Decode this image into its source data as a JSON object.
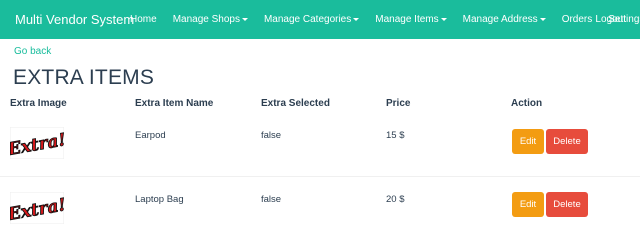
{
  "navbar": {
    "brand": "Multi Vendor System",
    "items": [
      {
        "label": "Home",
        "dropdown": false
      },
      {
        "label": "Manage Shops",
        "dropdown": true
      },
      {
        "label": "Manage Categories",
        "dropdown": true
      },
      {
        "label": "Manage Items",
        "dropdown": true
      },
      {
        "label": "Manage Address",
        "dropdown": true
      },
      {
        "label": "Orders",
        "dropdown": false
      },
      {
        "label": "Settings",
        "dropdown": true
      }
    ],
    "logout": "Logout"
  },
  "go_back": "Go back",
  "page_title": "EXTRA ITEMS",
  "table": {
    "headers": [
      "Extra Image",
      "Extra Item Name",
      "Extra Selected",
      "Price",
      "Action"
    ],
    "rows": [
      {
        "image_text": "Extra!",
        "name": "Earpod",
        "selected": "false",
        "price": "15 $",
        "edit": "Edit",
        "delete": "Delete"
      },
      {
        "image_text": "Extra!",
        "name": "Laptop Bag",
        "selected": "false",
        "price": "20 $",
        "edit": "Edit",
        "delete": "Delete"
      }
    ]
  },
  "colors": {
    "navbar": "#1abc9c",
    "edit_button": "#f39c12",
    "delete_button": "#e74c3c",
    "link": "#18bc9c"
  }
}
